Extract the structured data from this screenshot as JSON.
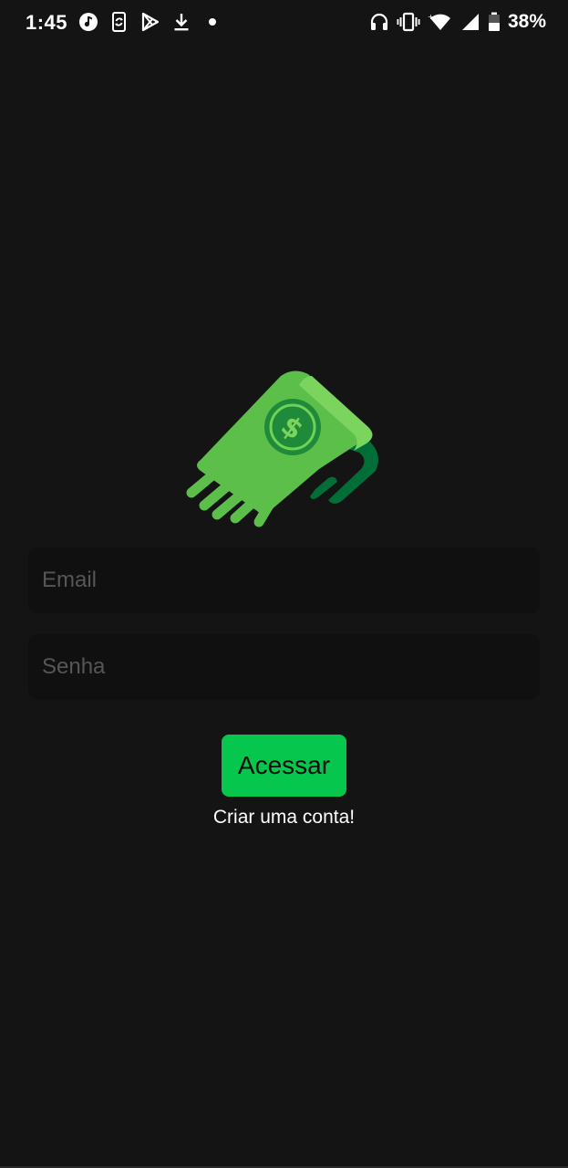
{
  "status_bar": {
    "time": "1:45",
    "battery": "38%",
    "left_icons": [
      "music-note-icon",
      "phone-sync-icon",
      "play-store-icon",
      "download-icon",
      "dot-icon"
    ],
    "right_icons": [
      "headphones-icon",
      "vibrate-icon",
      "wifi-icon",
      "signal-icon",
      "battery-icon"
    ]
  },
  "logo": {
    "icon": "flying-money-icon",
    "colors": {
      "primary": "#5cbf4a",
      "dark": "#006e36",
      "circle": "#1f8a3a"
    }
  },
  "form": {
    "email_placeholder": "Email",
    "email_value": "",
    "password_placeholder": "Senha",
    "password_value": "",
    "submit_label": "Acessar",
    "create_account_label": "Criar uma conta!"
  },
  "colors": {
    "background": "#141414",
    "input_background": "#101010",
    "accent": "#07c64d"
  }
}
